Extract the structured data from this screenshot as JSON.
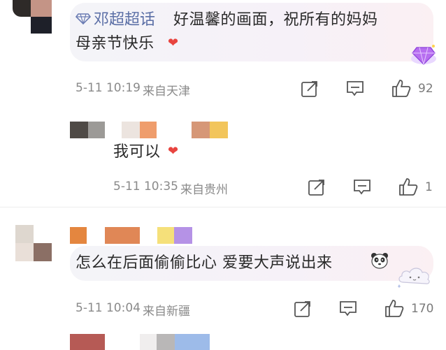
{
  "comments": [
    {
      "author": "邓超超话",
      "text": "好温馨的画面，祝所有的妈妈母亲节快乐",
      "text_line1": "好温馨的画面，祝所有的妈妈",
      "text_line2": "母亲节快乐",
      "time": "5-11 10:19",
      "location": "来自天津",
      "likes": "92"
    },
    {
      "text": "我可以",
      "time": "5-11 10:35",
      "location": "来自贵州",
      "likes": "1"
    },
    {
      "text": "怎么在后面偷偷比心 爱要大声说出来",
      "time": "5-11 10:04",
      "location": "来自新疆",
      "likes": "170"
    }
  ],
  "icons": {
    "heart": "heart-emoji",
    "panda": "panda-emoji",
    "diamond": "diamond-badge",
    "share": "share-icon",
    "comment": "comment-icon",
    "like": "thumbs-up-icon"
  },
  "colors": {
    "author_link": "#5b6fa6",
    "heart": "#e8443f"
  }
}
